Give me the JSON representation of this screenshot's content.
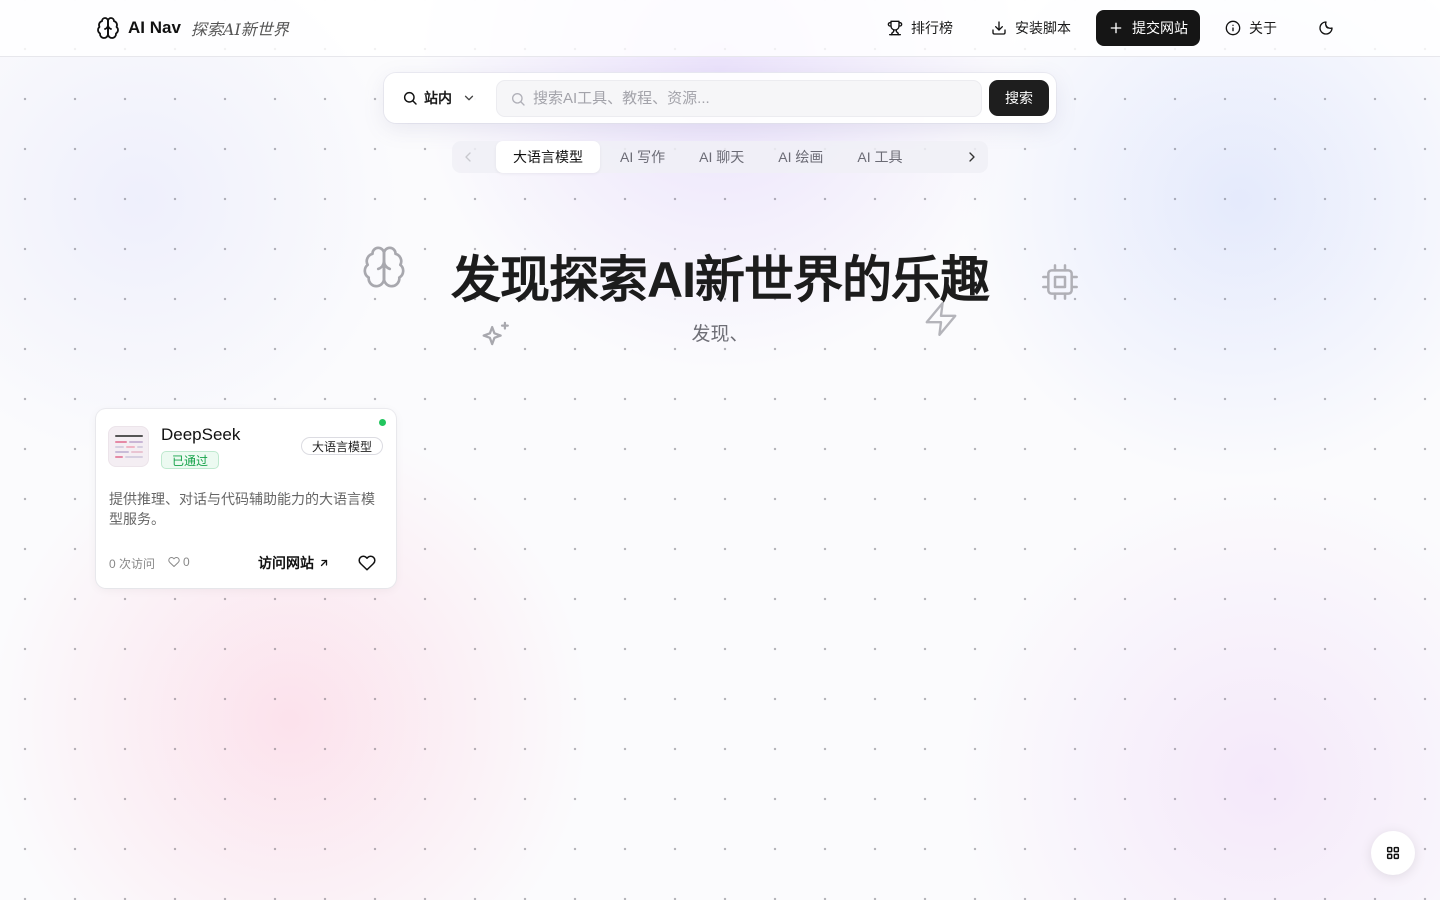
{
  "header": {
    "brand_name": "AI Nav",
    "brand_slogan": "探索AI新世界",
    "nav": {
      "ranking": "排行榜",
      "install_script": "安装脚本",
      "submit_site": "提交网站",
      "about": "关于"
    }
  },
  "search": {
    "scope": "站内",
    "placeholder": "搜索AI工具、教程、资源...",
    "button": "搜索"
  },
  "tabs": [
    {
      "label": "大语言模型",
      "active": true
    },
    {
      "label": "AI 写作",
      "active": false
    },
    {
      "label": "AI 聊天",
      "active": false
    },
    {
      "label": "AI 绘画",
      "active": false
    },
    {
      "label": "AI 工具",
      "active": false
    }
  ],
  "hero": {
    "title": "发现探索AI新世界的乐趣",
    "subtitle": "发现、"
  },
  "cards": [
    {
      "name": "DeepSeek",
      "status": "已通过",
      "category": "大语言模型",
      "description": "提供推理、对话与代码辅助能力的大语言模型服务。",
      "visits": "0 次访问",
      "likes": "0",
      "visit_label": "访问网站"
    }
  ],
  "icons": {
    "brand": "brain-icon",
    "ranking": "trophy-icon",
    "install": "download-icon",
    "submit": "plus-icon",
    "about": "info-icon",
    "theme": "theme-toggle-icon",
    "fab": "grid-icon"
  },
  "colors": {
    "primary": "#151515",
    "online": "#22c55e",
    "approved": "#16a34a"
  }
}
